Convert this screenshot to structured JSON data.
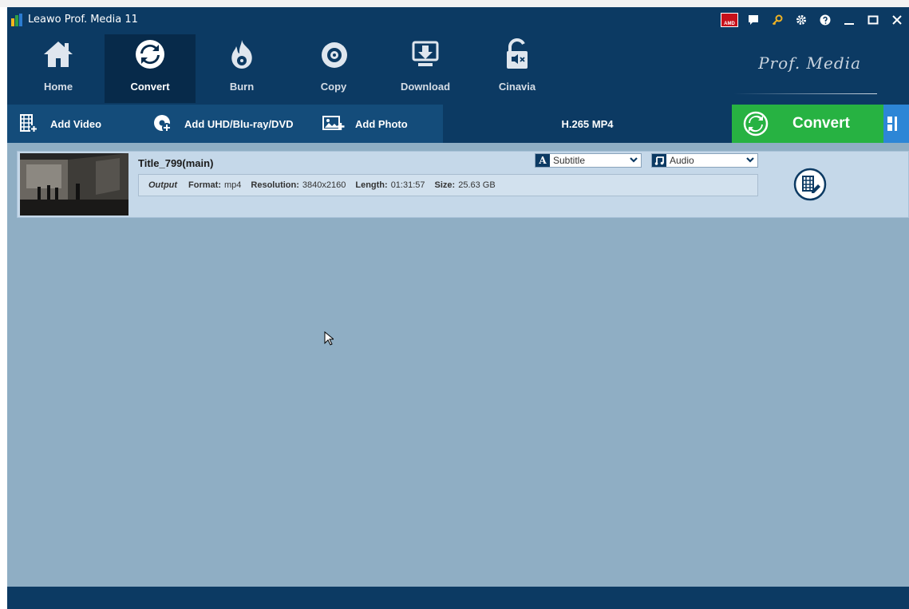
{
  "window": {
    "title": "Leawo Prof. Media 11"
  },
  "nav": {
    "items": [
      {
        "label": "Home",
        "icon": "home-icon"
      },
      {
        "label": "Convert",
        "icon": "convert-icon",
        "active": true
      },
      {
        "label": "Burn",
        "icon": "burn-icon"
      },
      {
        "label": "Copy",
        "icon": "copy-icon"
      },
      {
        "label": "Download",
        "icon": "download-icon"
      },
      {
        "label": "Cinavia",
        "icon": "cinavia-icon"
      }
    ],
    "brand": "Prof. Media"
  },
  "toolbar": {
    "add_video": "Add Video",
    "add_disc": "Add UHD/Blu-ray/DVD",
    "add_photo": "Add Photo",
    "format": "H.265 MP4",
    "convert": "Convert"
  },
  "file": {
    "title": "Title_799(main)",
    "output_label": "Output",
    "format_label": "Format:",
    "format_value": "mp4",
    "resolution_label": "Resolution:",
    "resolution_value": "3840x2160",
    "length_label": "Length:",
    "length_value": "01:31:57",
    "size_label": "Size:",
    "size_value": "25.63 GB",
    "subtitle_value": "Subtitle",
    "audio_value": "Audio"
  },
  "colors": {
    "titlebar": "#0c3a63",
    "toolbar": "#144c7a",
    "convert_green": "#27b242",
    "workspace": "#8faec4",
    "row_bg": "#c5d8e9"
  }
}
